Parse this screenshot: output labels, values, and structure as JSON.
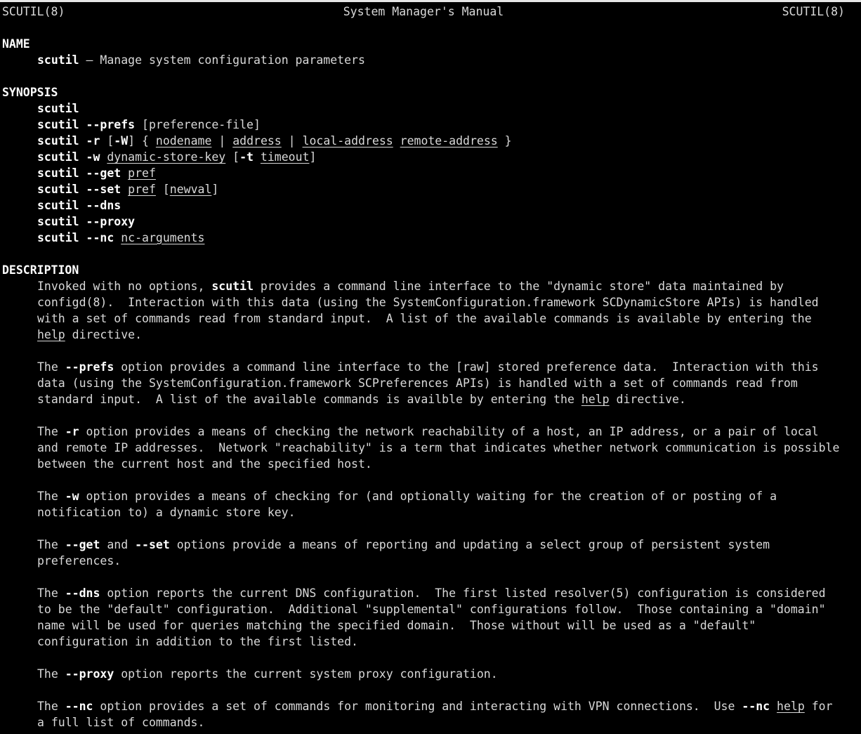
{
  "header": {
    "left": "SCUTIL(8)",
    "center": "System Manager's Manual",
    "right": "SCUTIL(8)"
  },
  "name_section": {
    "heading": "NAME",
    "cmd": "scutil",
    "desc": " – Manage system configuration parameters"
  },
  "synopsis": {
    "heading": "SYNOPSIS",
    "l1": {
      "cmd": "scutil"
    },
    "l2": {
      "cmd": "scutil --prefs",
      "rest": " [preference-file]"
    },
    "l3": {
      "cmd": "scutil -r",
      "t1": " [",
      "flag": "-W",
      "t2": "] { ",
      "a1": "nodename",
      "s1": " | ",
      "a2": "address",
      "s2": " | ",
      "a3": "local-address",
      "s3": " ",
      "a4": "remote-address",
      "t3": " }"
    },
    "l4": {
      "cmd": "scutil -w",
      "s1": " ",
      "a1": "dynamic-store-key",
      "t1": " [",
      "flag": "-t",
      "s2": " ",
      "a2": "timeout",
      "t2": "]"
    },
    "l5": {
      "cmd": "scutil --get",
      "s1": " ",
      "a1": "pref"
    },
    "l6": {
      "cmd": "scutil --set",
      "s1": " ",
      "a1": "pref",
      "t1": " [",
      "a2": "newval",
      "t2": "]"
    },
    "l7": {
      "cmd": "scutil --dns"
    },
    "l8": {
      "cmd": "scutil --proxy"
    },
    "l9": {
      "cmd": "scutil --nc",
      "s1": " ",
      "a1": "nc-arguments"
    }
  },
  "description": {
    "heading": "DESCRIPTION",
    "p1": {
      "l1a": "Invoked with no options, ",
      "l1b": "scutil",
      "l1c": " provides a command line interface to the \"dynamic store\" data maintained by",
      "l2": "configd(8).  Interaction with this data (using the SystemConfiguration.framework SCDynamicStore APIs) is handled",
      "l3": "with a set of commands read from standard input.  A list of the available commands is available by entering the",
      "l4a": "help",
      "l4b": " directive."
    },
    "p2": {
      "l1a": "The ",
      "l1b": "--prefs",
      "l1c": " option provides a command line interface to the [raw] stored preference data.  Interaction with this",
      "l2": "data (using the SystemConfiguration.framework SCPreferences APIs) is handled with a set of commands read from",
      "l3a": "standard input.  A list of the available commands is availble by entering the ",
      "l3b": "help",
      "l3c": " directive."
    },
    "p3": {
      "l1a": "The ",
      "l1b": "-r",
      "l1c": " option provides a means of checking the network reachability of a host, an IP address, or a pair of local",
      "l2": "and remote IP addresses.  Network \"reachability\" is a term that indicates whether network communication is possible",
      "l3": "between the current host and the specified host."
    },
    "p4": {
      "l1a": "The ",
      "l1b": "-w",
      "l1c": " option provides a means of checking for (and optionally waiting for the creation of or posting of a",
      "l2": "notification to) a dynamic store key."
    },
    "p5": {
      "l1a": "The ",
      "l1b": "--get",
      "l1c": " and ",
      "l1d": "--set",
      "l1e": " options provide a means of reporting and updating a select group of persistent system",
      "l2": "preferences."
    },
    "p6": {
      "l1a": "The ",
      "l1b": "--dns",
      "l1c": " option reports the current DNS configuration.  The first listed resolver(5) configuration is considered",
      "l2": "to be the \"default\" configuration.  Additional \"supplemental\" configurations follow.  Those containing a \"domain\"",
      "l3": "name will be used for queries matching the specified domain.  Those without will be used as a \"default\"",
      "l4": "configuration in addition to the first listed."
    },
    "p7": {
      "l1a": "The ",
      "l1b": "--proxy",
      "l1c": " option reports the current system proxy configuration."
    },
    "p8": {
      "l1a": "The ",
      "l1b": "--nc",
      "l1c": " option provides a set of commands for monitoring and interacting with VPN connections.  Use ",
      "l1d": "--nc",
      "l1e": " ",
      "l1f": "help",
      "l1g": " for",
      "l2": "a full list of commands."
    }
  }
}
